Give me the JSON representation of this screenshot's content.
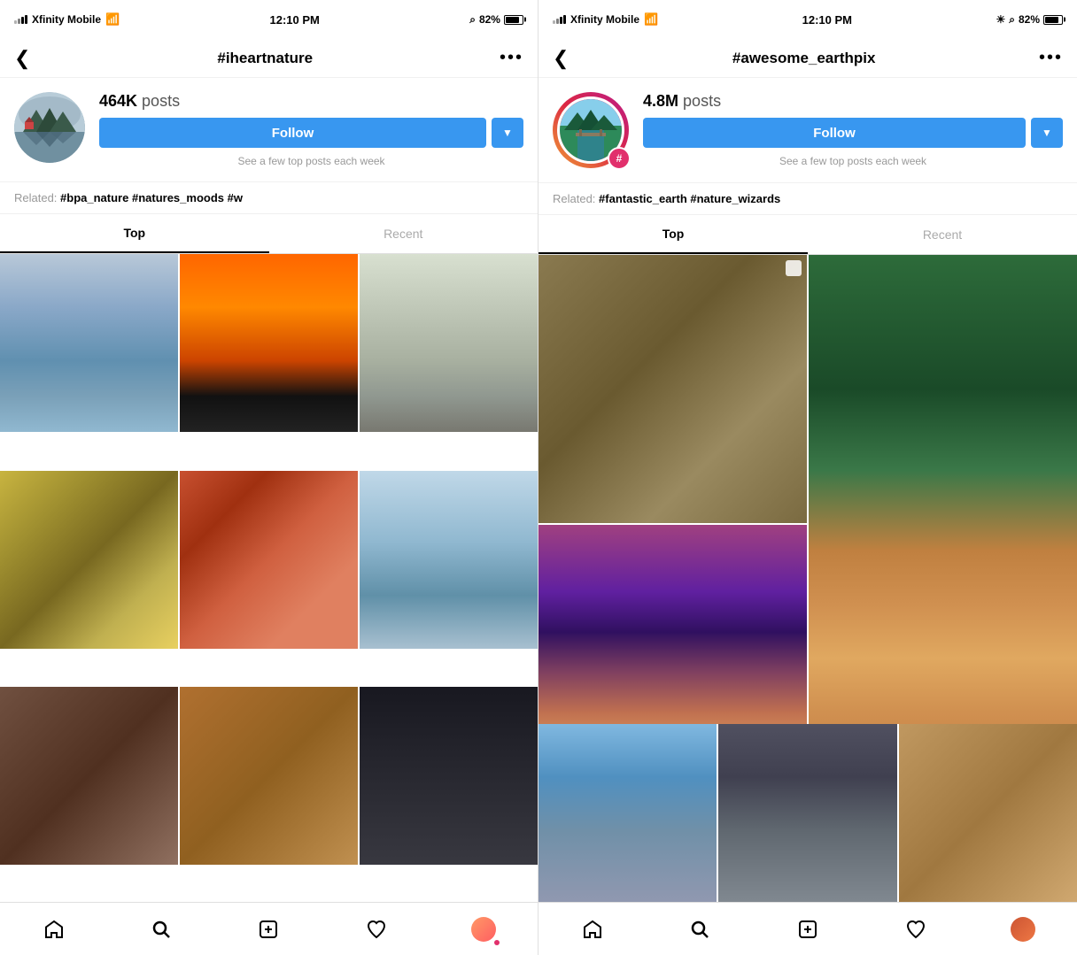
{
  "panel1": {
    "statusBar": {
      "carrier": "Xfinity Mobile",
      "time": "12:10 PM",
      "battery": "82%"
    },
    "header": {
      "title": "#iheartnature",
      "backLabel": "<",
      "moreLabel": "..."
    },
    "profile": {
      "postCount": "464K",
      "postsLabel": "posts",
      "followLabel": "Follow",
      "hint": "See a few top posts each week"
    },
    "related": {
      "label": "Related:",
      "tags": "#bpa_nature  #natures_moods  #w"
    },
    "tabs": {
      "active": "Top",
      "inactive": "Recent"
    },
    "bottomNav": {
      "home": "home",
      "search": "search",
      "add": "add",
      "heart": "heart",
      "profile": "profile"
    }
  },
  "panel2": {
    "statusBar": {
      "carrier": "Xfinity Mobile",
      "time": "12:10 PM",
      "battery": "82%"
    },
    "header": {
      "title": "#awesome_earthpix",
      "backLabel": "<",
      "moreLabel": "..."
    },
    "profile": {
      "postCount": "4.8M",
      "postsLabel": "posts",
      "followLabel": "Follow",
      "hint": "See a few top posts each week"
    },
    "related": {
      "label": "Related:",
      "tags": "#fantastic_earth  #nature_wizards"
    },
    "tabs": {
      "active": "Top",
      "inactive": "Recent"
    },
    "bottomNav": {
      "home": "home",
      "search": "search",
      "add": "add",
      "heart": "heart",
      "profile": "profile"
    }
  }
}
